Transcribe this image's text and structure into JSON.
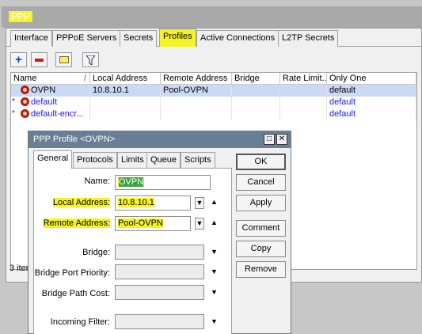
{
  "window": {
    "title": "PPP"
  },
  "tabs": [
    "Interface",
    "PPPoE Servers",
    "Secrets",
    "Profiles",
    "Active Connections",
    "L2TP Secrets"
  ],
  "toolbar": {
    "add": "+",
    "remove": "−",
    "filter": "▼"
  },
  "table": {
    "columns": [
      "Name",
      "Local Address",
      "Remote Address",
      "Bridge",
      "Rate Limit...",
      "Only One"
    ],
    "rows": [
      {
        "marker": "",
        "name": "OVPN",
        "local": "10.8.10.1",
        "remote": "Pool-OVPN",
        "bridge": "",
        "rate": "",
        "only_one": "default"
      },
      {
        "marker": "*",
        "name": "default",
        "local": "",
        "remote": "",
        "bridge": "",
        "rate": "",
        "only_one": "default"
      },
      {
        "marker": "*",
        "name": "default-encr...",
        "local": "",
        "remote": "",
        "bridge": "",
        "rate": "",
        "only_one": "default"
      }
    ],
    "items_count": "3 iter"
  },
  "dialog": {
    "title": "PPP Profile <OVPN>",
    "tabs": [
      "General",
      "Protocols",
      "Limits",
      "Queue",
      "Scripts"
    ],
    "fields": {
      "name_label": "Name:",
      "name_value": "OVPN",
      "local_label": "Local Address:",
      "local_value": "10.8.10.1",
      "remote_label": "Remote Address:",
      "remote_value": "Pool-OVPN",
      "bridge_label": "Bridge:",
      "bpp_label": "Bridge Port Priority:",
      "bpc_label": "Bridge Path Cost:",
      "incoming_label": "Incoming Filter:"
    },
    "buttons": [
      "OK",
      "Cancel",
      "Apply",
      "Comment",
      "Copy",
      "Remove"
    ],
    "ctl_restore": "□",
    "ctl_close": "✕"
  },
  "colors": {
    "highlight": "#f6f425",
    "selection": "#cad9f5",
    "title_bar": "#6a7f96"
  }
}
